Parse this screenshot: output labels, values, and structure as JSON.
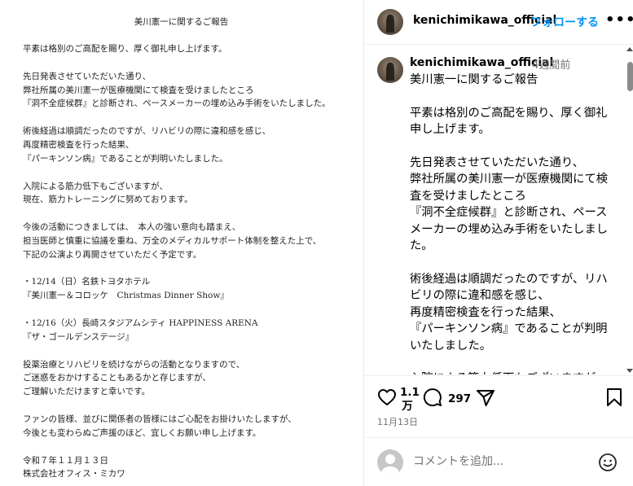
{
  "document": {
    "title": "美川憲一に関するご報告",
    "lines": [
      "平素は格別のご高配を賜り、厚く御礼申し上げます。",
      "",
      "先日発表させていただいた通り、",
      "弊社所属の美川憲一が医療機関にて検査を受けましたところ",
      "『洞不全症候群』と診断され、ペースメーカーの埋め込み手術をいたしました。",
      "",
      "術後経過は順調だったのですが、リハビリの際に違和感を感じ、",
      "再度精密検査を行った結果、",
      "『パーキンソン病』であることが判明いたしました。",
      "",
      "入院による筋力低下もございますが、",
      "現在、筋力トレーニングに努めております。",
      "",
      "今後の活動につきましては、　本人の強い意向も踏まえ、",
      "担当医師と慎重に協議を重ね、万全のメディカルサポート体制を整えた上で、",
      "下記の公演より再開させていただく予定です。",
      "",
      "・12/14（日）名鉄トヨタホテル",
      "『美川憲一＆コロッケ　Christmas Dinner Show』",
      "",
      "・12/16（火）長崎スタジアムシティ  HAPPINESS ARENA",
      "『ザ・ゴールデンステージ』",
      "",
      "投薬治療とリハビリを続けながらの活動となりますので、",
      "ご迷惑をおかけすることもあるかと存じますが、",
      "ご理解いただけますと幸いです。",
      "",
      "ファンの皆様、並びに関係者の皆様にはご心配をお掛けいたしますが、",
      "今後とも変わらぬご声援のほど、宜しくお願い申し上げます。",
      "",
      "令和７年１１月１３日",
      "株式会社オフィス・ミカワ"
    ]
  },
  "header": {
    "username": "kenichimikawa_official",
    "follow_label": "フォローする",
    "more_label": "•••"
  },
  "caption": {
    "username": "kenichimikawa_official",
    "time_ago": "4週間前",
    "text": "美川憲一に関するご報告\n\n平素は格別のご高配を賜り、厚く御礼申し上げます。\n\n先日発表させていただいた通り、\n弊社所属の美川憲一が医療機関にて検査を受けましたところ\n『洞不全症候群』と診断され、ペースメーカーの埋め込み手術をいたしました。\n\n術後経過は順調だったのですが、リハビリの際に違和感を感じ、\n再度精密検査を行った結果、\n『パーキンソン病』であることが判明いたしました。\n\n入院による筋力低下もございますが、\n現在、筋力トレーニングに努めております。"
  },
  "actions": {
    "like_count": "1.1万",
    "comment_count": "297",
    "date": "11月13日"
  },
  "comment_box": {
    "placeholder": "コメントを追加..."
  },
  "icons": {
    "like": "heart-outline-icon",
    "comment": "comment-bubble-icon",
    "share": "paper-plane-icon",
    "save": "bookmark-outline-icon",
    "emoji": "smiley-icon",
    "more": "ellipsis-icon"
  },
  "colors": {
    "link_blue": "#0095f6",
    "secondary_text": "#737373",
    "border": "#efefef"
  }
}
